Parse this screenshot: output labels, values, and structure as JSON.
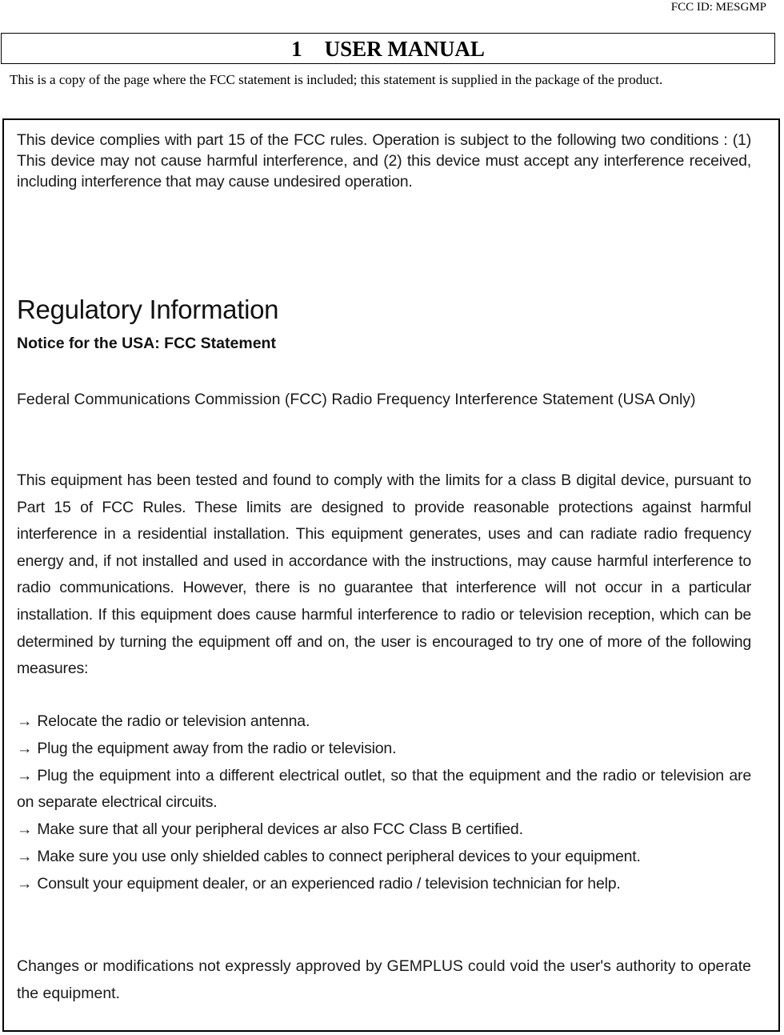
{
  "header": {
    "fcc_id": "FCC ID: MESGMP",
    "section_number": "1",
    "section_title": "USER MANUAL",
    "intro": "This is a copy of the page where the FCC statement is included; this statement is supplied in the package of the product."
  },
  "scan": {
    "compliance_paragraph": "This device complies with part 15 of the FCC rules. Operation is subject to the following two conditions : (1) This device may not cause harmful interference, and (2) this device must accept any interference received, including interference that may cause undesired operation.",
    "heading": "Regulatory Information",
    "subheading": "Notice for the USA: FCC Statement",
    "rf_statement_title": "Federal Communications Commission (FCC) Radio Frequency Interference Statement (USA Only)",
    "body_paragraph": "This equipment has been tested and found to comply with the limits for a class B digital device, pursuant to Part 15 of FCC Rules. These limits are designed to provide reasonable protections against harmful interference in a residential installation. This equipment generates, uses and can radiate radio frequency energy and, if not installed and used in accordance with the instructions, may cause harmful interference to radio communications. However, there is no guarantee that interference will not occur in a particular installation. If this equipment does cause harmful interference to radio or television reception, which can be determined by turning the equipment off and on, the user is encouraged to try one of more of the following measures:",
    "bullet_glyph": "→",
    "measures": [
      "Relocate the radio or television antenna.",
      "Plug the equipment away from the radio or television.",
      "Plug the equipment into a different electrical outlet, so that the equipment and the radio or television are on separate electrical circuits.",
      "Make sure that all your peripheral devices ar also FCC Class B certified.",
      "Make sure you use only shielded cables to connect peripheral devices to your equipment.",
      "Consult your equipment dealer, or an experienced radio / television technician for help."
    ],
    "closing_paragraph": "Changes or modifications not expressly approved by GEMPLUS could void the user's authority to operate the equipment."
  }
}
